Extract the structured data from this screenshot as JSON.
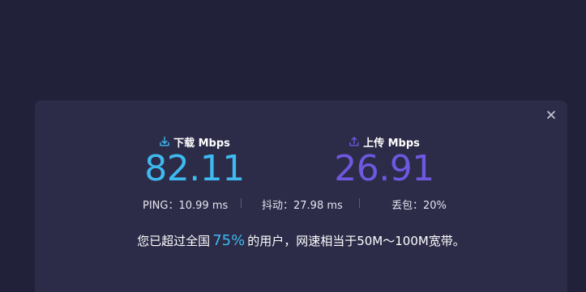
{
  "dialog": {
    "close_icon": "close-icon",
    "download": {
      "icon": "download-icon",
      "label": "下载 Mbps",
      "value": "82.11",
      "color": "#3ebaf0"
    },
    "upload": {
      "icon": "upload-icon",
      "label": "上传 Mbps",
      "value": "26.91",
      "color": "#6e58e0"
    },
    "stats": {
      "ping": "PING：10.99 ms",
      "jitter": "抖动：27.98 ms",
      "loss": "丢包：20%"
    },
    "summary": {
      "prefix": "您已超过全国",
      "percent": "75%",
      "suffix": "的用户，网速相当于50M～100M宽带。"
    }
  }
}
